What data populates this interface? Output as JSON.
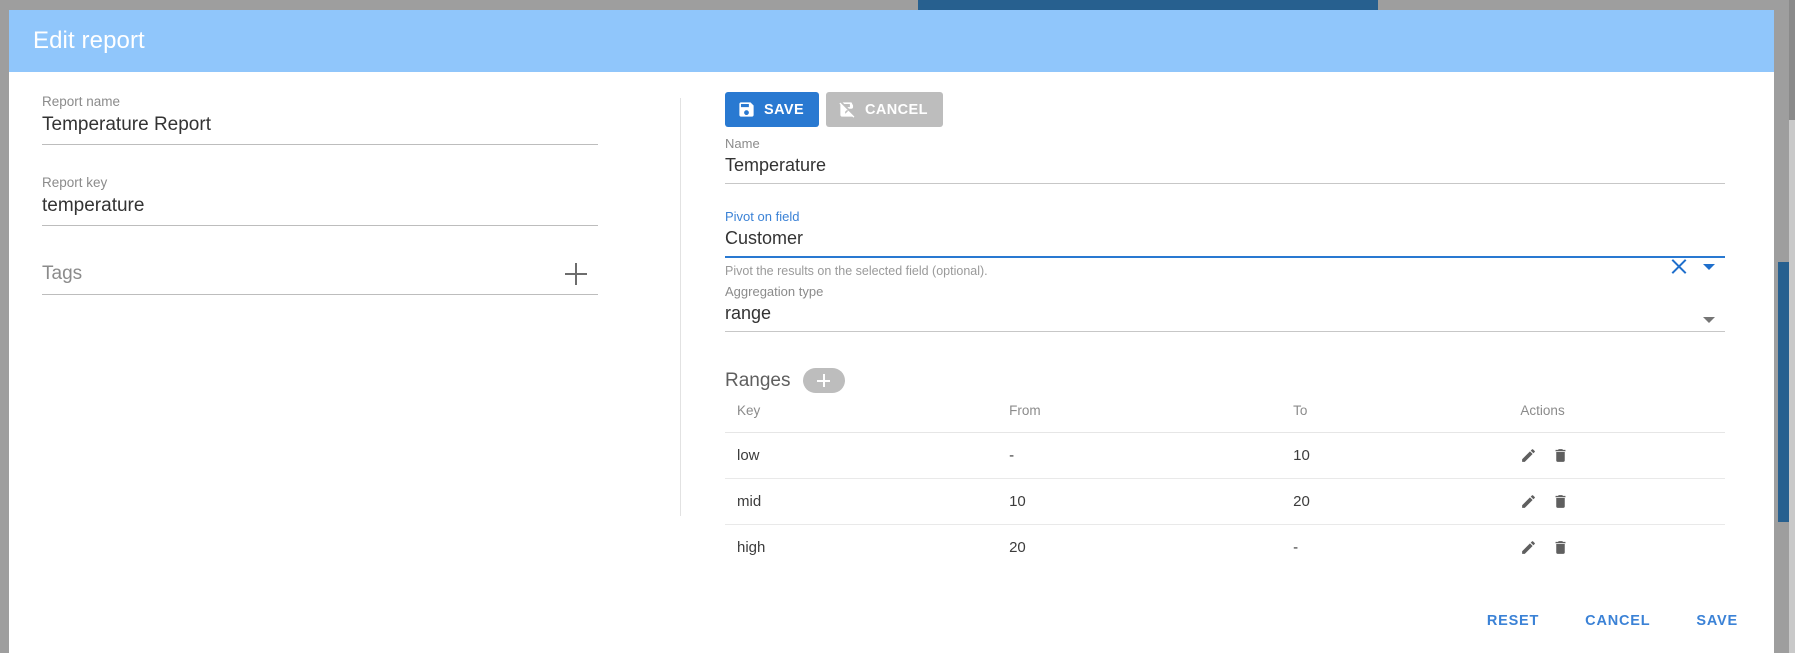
{
  "dialog": {
    "title": "Edit report",
    "actions": {
      "reset": "RESET",
      "cancel": "CANCEL",
      "save": "SAVE"
    }
  },
  "left": {
    "report_name": {
      "label": "Report name",
      "value": "Temperature Report"
    },
    "report_key": {
      "label": "Report key",
      "value": "temperature"
    },
    "tags": {
      "label": "Tags",
      "add_icon": "plus-icon"
    }
  },
  "right": {
    "toolbar": {
      "save_label": "SAVE",
      "cancel_label": "CANCEL",
      "save_icon": "save-icon",
      "cancel_icon": "save-off-icon"
    },
    "name_field": {
      "label": "Name",
      "value": "Temperature"
    },
    "pivot_field": {
      "label": "Pivot on field",
      "value": "Customer",
      "hint": "Pivot the results on the selected field (optional).",
      "clear_icon": "close-icon",
      "dropdown_icon": "chevron-down-icon"
    },
    "aggregation_field": {
      "label": "Aggregation type",
      "value": "range",
      "dropdown_icon": "chevron-down-icon"
    },
    "ranges": {
      "title": "Ranges",
      "add_icon": "plus-icon",
      "columns": [
        "Key",
        "From",
        "To",
        "Actions"
      ],
      "rows": [
        {
          "key": "low",
          "from": "-",
          "to": "10"
        },
        {
          "key": "mid",
          "from": "10",
          "to": "20"
        },
        {
          "key": "high",
          "from": "20",
          "to": "-"
        }
      ],
      "row_actions": {
        "edit_icon": "pencil-icon",
        "delete_icon": "trash-icon"
      }
    }
  },
  "colors": {
    "header": "#90c6fb",
    "primary": "#2979d1",
    "accent_link": "#3b82d6",
    "disabled": "#bdbdbd",
    "page_bg": "#9e9e9e"
  }
}
